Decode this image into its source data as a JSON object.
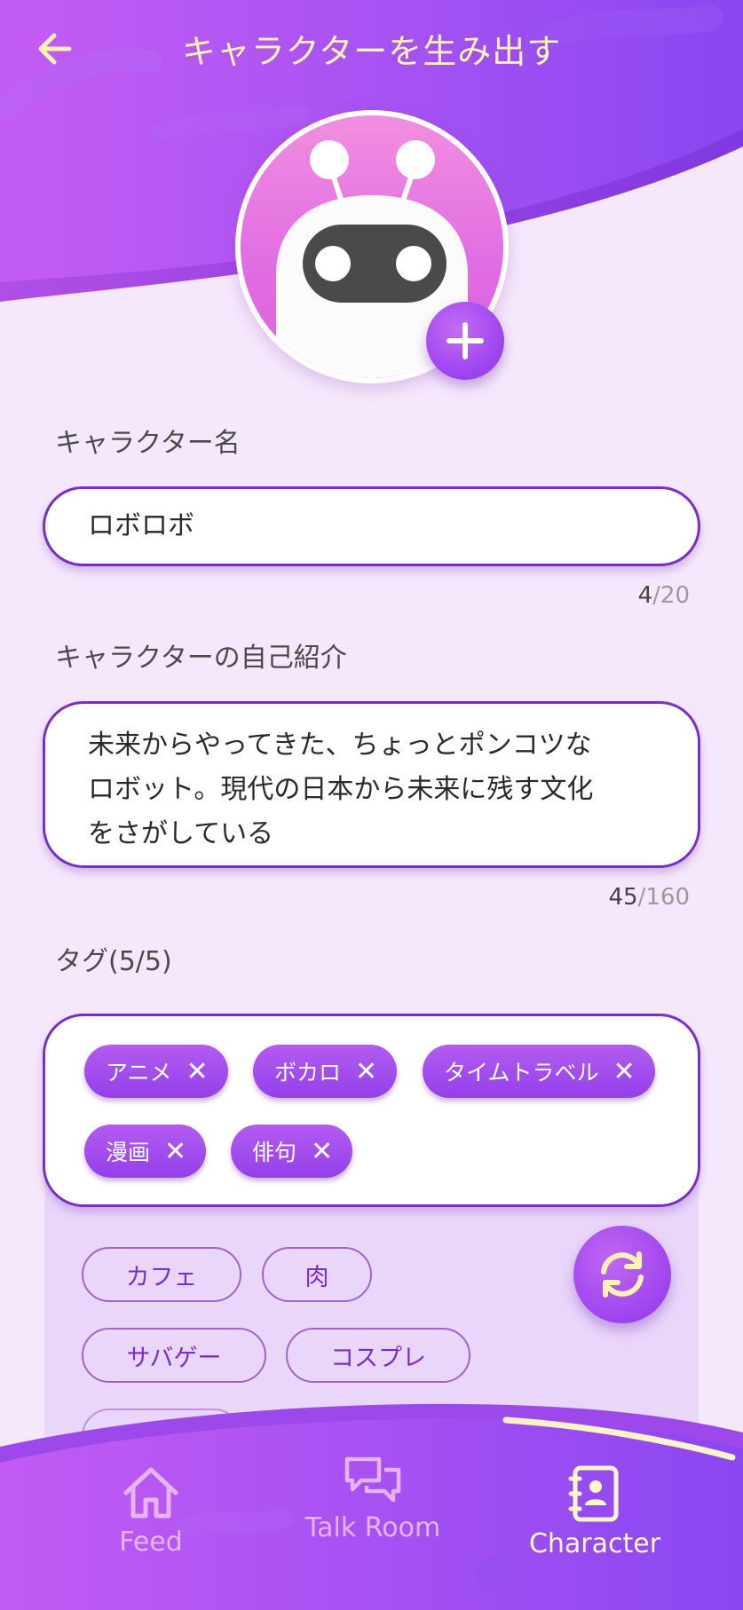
{
  "header": {
    "title": "キャラクターを生み出す"
  },
  "icons": {
    "back": "arrow-left-icon",
    "add": "plus-icon",
    "refresh": "refresh-icon",
    "remove": "close-icon"
  },
  "colors": {
    "accent": "#9b42f0",
    "header_text": "#fdf3b2",
    "field_border": "#7a2ec9"
  },
  "form": {
    "name": {
      "label": "キャラクター名",
      "value": "ロボロボ",
      "count": "4",
      "max": "/20"
    },
    "intro": {
      "label": "キャラクターの自己紹介",
      "lines": [
        "未来からやってきた、ちょっとポンコツな",
        "ロボット。現代の日本から未来に残す文化",
        "をさがしている"
      ],
      "count": "45",
      "max": "/160"
    },
    "tags": {
      "label": "タグ(5/5)",
      "selected": [
        "アニメ",
        "ボカロ",
        "タイムトラベル",
        "漫画",
        "俳句"
      ],
      "remove_symbol": "✕",
      "suggestions": [
        "カフェ",
        "肉",
        "サバゲー",
        "コスプレ"
      ]
    }
  },
  "nav": {
    "items": [
      {
        "label": "Feed",
        "icon": "home-icon"
      },
      {
        "label": "Talk Room",
        "icon": "chat-icon"
      },
      {
        "label": "Character",
        "icon": "contact-book-icon"
      }
    ],
    "active": "Character"
  }
}
